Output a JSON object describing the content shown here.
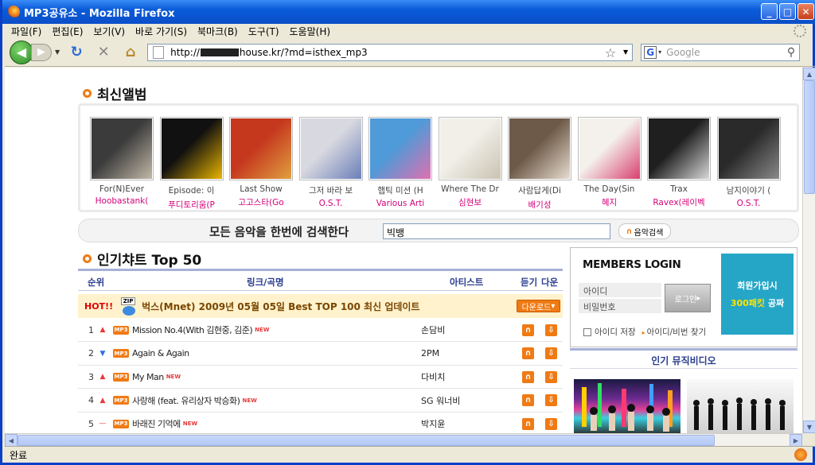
{
  "window": {
    "title": "MP3공유소 - Mozilla Firefox"
  },
  "menu": [
    "파일(F)",
    "편집(E)",
    "보기(V)",
    "바로 가기(S)",
    "북마크(B)",
    "도구(T)",
    "도움말(H)"
  ],
  "address": {
    "prefix": "http://",
    "suffix": "house.kr/?md=isthex_mp3"
  },
  "browser_search": {
    "placeholder": "Google",
    "engine": "G"
  },
  "sections": {
    "new_albums": "최신앨범",
    "chart": "인기챠트 Top 50",
    "music_videos": "인기 뮤직비디오"
  },
  "albums": [
    {
      "title": "For(N)Ever",
      "artist": "Hoobastank(",
      "colors": [
        "#3b3b3b",
        "#c2b8a8"
      ]
    },
    {
      "title": "Episode: 이",
      "artist": "푸디토리움(P",
      "colors": [
        "#111111",
        "#e8b400"
      ]
    },
    {
      "title": "Last Show",
      "artist": "고고스타(Go",
      "colors": [
        "#c6381e",
        "#e0a040"
      ]
    },
    {
      "title": "그저 바라 보",
      "artist": "O.S.T.",
      "colors": [
        "#d8d8e0",
        "#6a7fb8"
      ]
    },
    {
      "title": "햅틱 미션 (H",
      "artist": "Various Arti",
      "colors": [
        "#4f9ad8",
        "#e070b0"
      ]
    },
    {
      "title": "Where The Dr",
      "artist": "심현보",
      "colors": [
        "#f1efe8",
        "#c9c3b2"
      ]
    },
    {
      "title": "사람답게(Di",
      "artist": "배기성",
      "colors": [
        "#6e5a48",
        "#e7ddd0"
      ]
    },
    {
      "title": "The Day(Sin",
      "artist": "혜지",
      "colors": [
        "#f4f1ec",
        "#d84070"
      ]
    },
    {
      "title": "Trax",
      "artist": "Ravex(레이벡",
      "colors": [
        "#1f1f1f",
        "#d8d8d8"
      ]
    },
    {
      "title": "남지이야기 (",
      "artist": "O.S.T.",
      "colors": [
        "#2a2a2a",
        "#8a8a8a"
      ]
    }
  ],
  "music_search": {
    "label": "모든 음악을 한번에 검색한다",
    "value": "빅뱅",
    "button": "음악검색"
  },
  "chart_header": {
    "rank": "순위",
    "song": "링크/곡명",
    "artist": "아티스트",
    "listen": "듣기",
    "download": "다운"
  },
  "hot": {
    "badge": "HOT!!",
    "zip": "ZIP",
    "text": "벅스(Mnet) 2009년 05월 05일 Best TOP 100 최신 업데이트",
    "button": "다운로드"
  },
  "chart_rows": [
    {
      "rank": "1",
      "trend": "up",
      "song": "Mission No.4(With 김현중, 김준)",
      "new": true,
      "artist": "손담비"
    },
    {
      "rank": "2",
      "trend": "down",
      "song": "Again & Again",
      "new": false,
      "artist": "2PM"
    },
    {
      "rank": "3",
      "trend": "up",
      "song": "My Man",
      "new": true,
      "artist": "다비치"
    },
    {
      "rank": "4",
      "trend": "up",
      "song": "사랑해 (feat. 유리상자 박승화)",
      "new": true,
      "artist": "SG 워너비"
    },
    {
      "rank": "5",
      "trend": "same",
      "song": "바래진 기억에",
      "new": true,
      "artist": "박지윤"
    }
  ],
  "tags": {
    "mp3": "MP3",
    "new": "NEW"
  },
  "login": {
    "title": "MEMBERS LOGIN",
    "id_placeholder": "아이디",
    "pw_placeholder": "비밀번호",
    "button": "로그인",
    "save": "아이디 저장",
    "find": "아이디/비번 찾기",
    "join_line1": "회원가입시",
    "join_line2a": "300패킷",
    "join_line2b": "공짜"
  },
  "status": {
    "text": "완료"
  },
  "colors": {
    "accent": "#f07a13",
    "pink": "#d4007a",
    "navy": "#2a3d8f",
    "join": "#25a6c6"
  }
}
